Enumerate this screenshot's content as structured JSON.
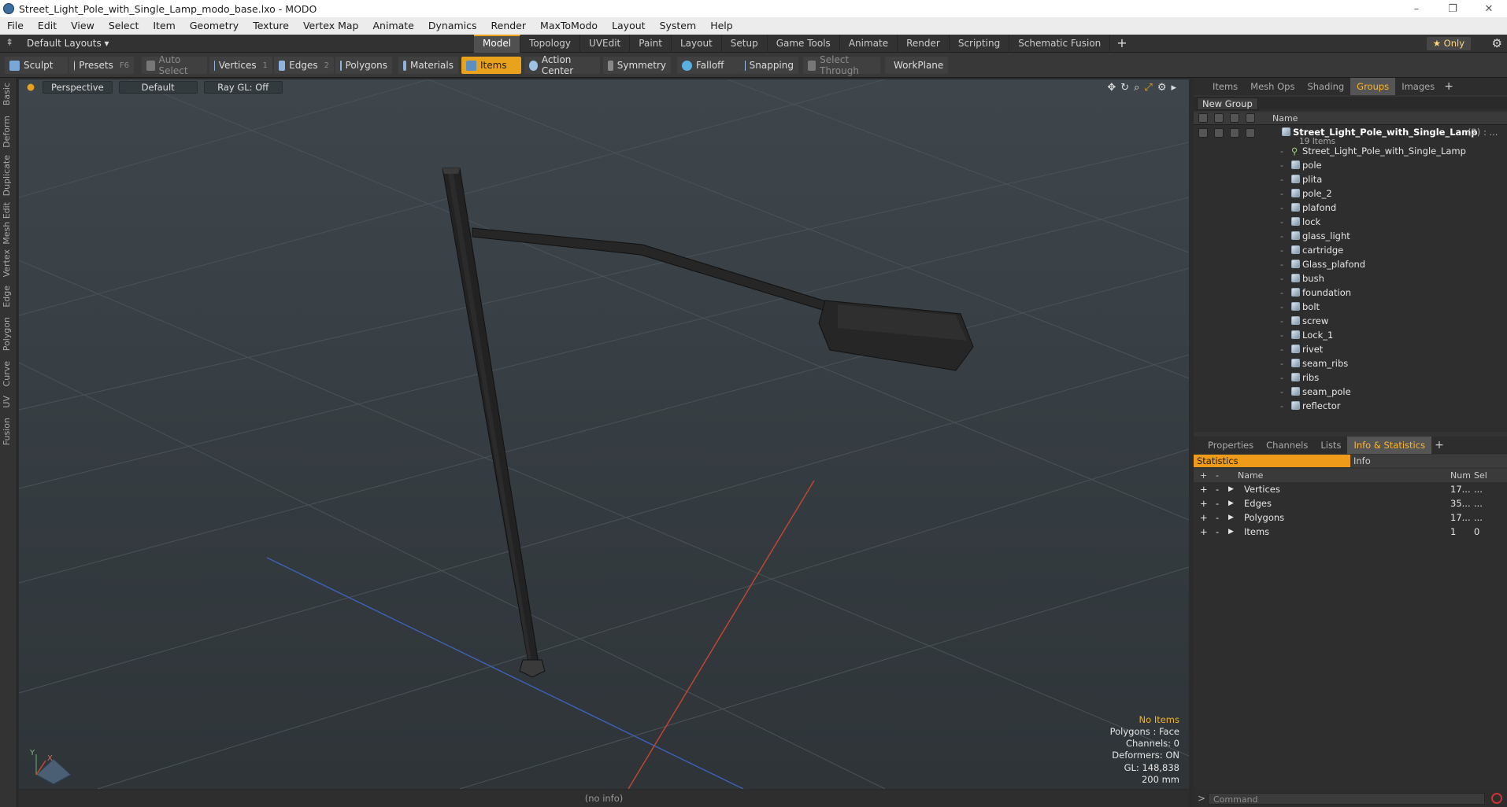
{
  "window": {
    "title": "Street_Light_Pole_with_Single_Lamp_modo_base.lxo - MODO",
    "min": "–",
    "max": "❐",
    "close": "✕"
  },
  "menu": [
    "File",
    "Edit",
    "View",
    "Select",
    "Item",
    "Geometry",
    "Texture",
    "Vertex Map",
    "Animate",
    "Dynamics",
    "Render",
    "MaxToModo",
    "Layout",
    "System",
    "Help"
  ],
  "layoutbar": {
    "layout_name": "Default Layouts ▾",
    "tabs": [
      "Model",
      "Topology",
      "UVEdit",
      "Paint",
      "Layout",
      "Setup",
      "Game Tools",
      "Animate",
      "Render",
      "Scripting",
      "Schematic Fusion"
    ],
    "active_tab": "Model",
    "plus": "+",
    "only": "★ Only",
    "gear": "⚙"
  },
  "toolbar": {
    "sculpt": "Sculpt",
    "presets": "Presets",
    "presets_key": "F6",
    "auto_select": "Auto Select",
    "vertices": "Vertices",
    "vertices_n": "1",
    "edges": "Edges",
    "edges_n": "2",
    "polygons": "Polygons",
    "materials": "Materials",
    "items": "Items",
    "action_center": "Action Center",
    "symmetry": "Symmetry",
    "falloff": "Falloff",
    "snapping": "Snapping",
    "select_through": "Select Through",
    "workplane": "WorkPlane"
  },
  "left_tabs": [
    "Basic",
    "Deform",
    "Duplicate",
    "Mesh Edit",
    "Vertex",
    "Edge",
    "Polygon",
    "Curve",
    "UV",
    "Fusion"
  ],
  "viewport": {
    "perspective": "Perspective",
    "default": "Default",
    "raygl": "Ray GL: Off",
    "info": {
      "items": "No Items",
      "polygons": "Polygons : Face",
      "channels": "Channels: 0",
      "deformers": "Deformers: ON",
      "gl": "GL: 148,838",
      "scale": "200 mm"
    },
    "axis_x": "X",
    "axis_y": "Y"
  },
  "status": "(no info)",
  "panel_top": {
    "tabs": [
      "Items",
      "Mesh Ops",
      "Shading",
      "Groups",
      "Images"
    ],
    "active": "Groups",
    "plus": "+",
    "new_group": "New Group",
    "name_col": "Name",
    "group": {
      "name": "Street_Light_Pole_with_Single_Lamp",
      "count": "(2) : ...",
      "sub": "19 Items"
    },
    "items": [
      "Street_Light_Pole_with_Single_Lamp",
      "pole",
      "plita",
      "pole_2",
      "plafond",
      "lock",
      "glass_light",
      "cartridge",
      "Glass_plafond",
      "bush",
      "foundation",
      "bolt",
      "screw",
      "Lock_1",
      "rivet",
      "seam_ribs",
      "ribs",
      "seam_pole",
      "reflector"
    ]
  },
  "panel_bottom": {
    "tabs": [
      "Properties",
      "Channels",
      "Lists",
      "Info & Statistics"
    ],
    "active": "Info & Statistics",
    "plus": "+",
    "sub_tabs": [
      "Statistics",
      "Info"
    ],
    "cols": {
      "plus": "+",
      "minus": "-",
      "name": "Name",
      "num": "Num",
      "sel": "Sel"
    },
    "rows": [
      {
        "name": "Vertices",
        "num": "17...",
        "sel": "..."
      },
      {
        "name": "Edges",
        "num": "35...",
        "sel": "..."
      },
      {
        "name": "Polygons",
        "num": "17...",
        "sel": "..."
      },
      {
        "name": "Items",
        "num": "1",
        "sel": "0"
      }
    ]
  },
  "command": {
    "prompt": ">",
    "placeholder": "Command"
  }
}
